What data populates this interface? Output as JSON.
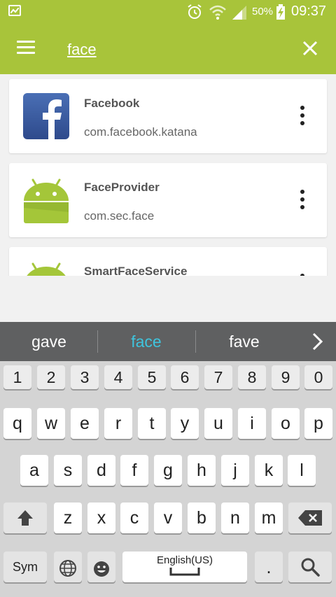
{
  "status_bar": {
    "battery_percent": "50%",
    "time": "09:37"
  },
  "search": {
    "query": "face"
  },
  "results": [
    {
      "name": "Facebook",
      "package": "com.facebook.katana",
      "icon": "facebook-icon"
    },
    {
      "name": "FaceProvider",
      "package": "com.sec.face",
      "icon": "android-icon"
    },
    {
      "name": "SmartFaceService",
      "package": "",
      "icon": "android-icon"
    }
  ],
  "suggestions": [
    "gave",
    "face",
    "fave"
  ],
  "keyboard": {
    "numbers": [
      "1",
      "2",
      "3",
      "4",
      "5",
      "6",
      "7",
      "8",
      "9",
      "0"
    ],
    "row1": [
      "q",
      "w",
      "e",
      "r",
      "t",
      "y",
      "u",
      "i",
      "o",
      "p"
    ],
    "row2": [
      "a",
      "s",
      "d",
      "f",
      "g",
      "h",
      "j",
      "k",
      "l"
    ],
    "row3": [
      "z",
      "x",
      "c",
      "v",
      "b",
      "n",
      "m"
    ],
    "sym_label": "Sym",
    "space_label": "English(US)",
    "period_label": "."
  },
  "colors": {
    "accent": "#a8c43a",
    "suggestion_active": "#3fc4dd"
  }
}
